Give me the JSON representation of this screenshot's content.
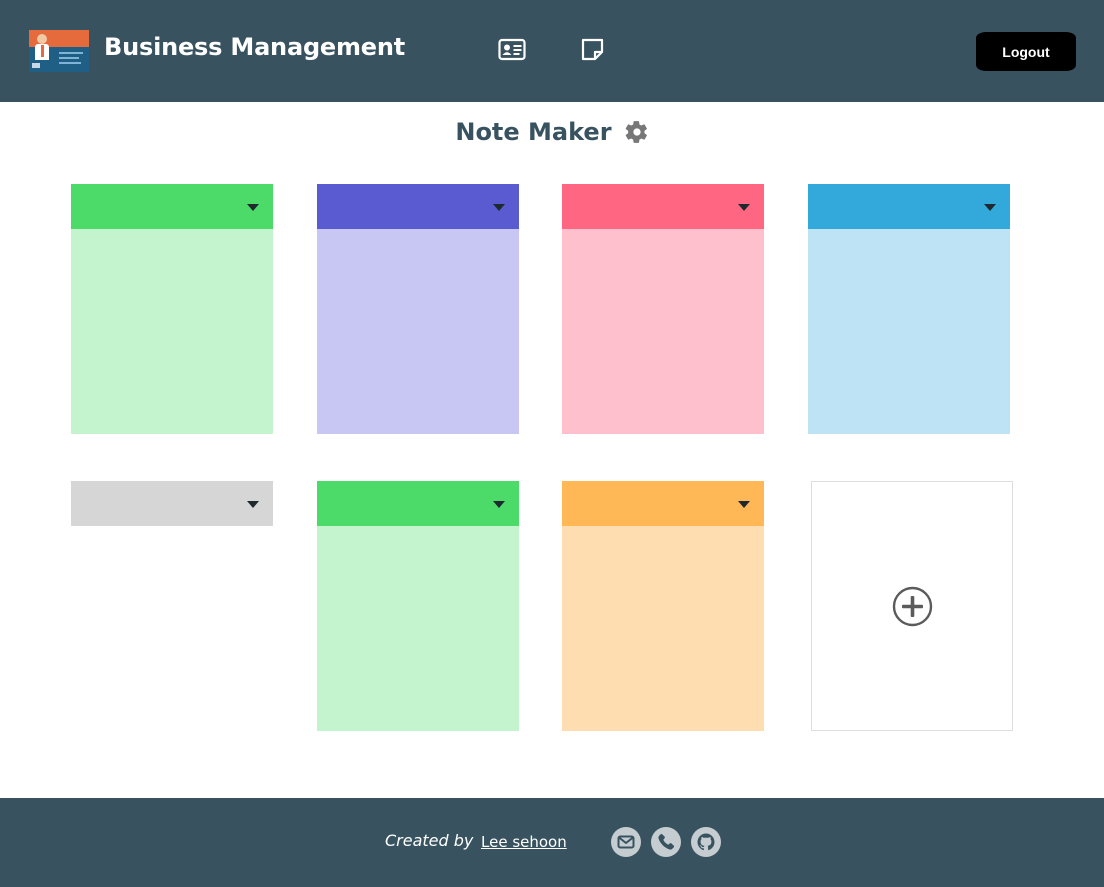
{
  "header": {
    "title": "Business Management",
    "nav": [
      {
        "icon": "id-card-icon"
      },
      {
        "icon": "sticky-note-icon"
      }
    ],
    "logout_label": "Logout",
    "background": "#38535f"
  },
  "main": {
    "title": "Note Maker",
    "settings_icon": "gear-icon",
    "notes": [
      {
        "header_color": "#4cdb68",
        "body_color": "#c4f4cd",
        "collapsed": false
      },
      {
        "header_color": "#5b5bd1",
        "body_color": "#c8c7f4",
        "collapsed": false
      },
      {
        "header_color": "#ff6681",
        "body_color": "#ffc0cd",
        "collapsed": false
      },
      {
        "header_color": "#33a8db",
        "body_color": "#bde3f5",
        "collapsed": false
      },
      {
        "header_color": "#d6d6d6",
        "body_color": "#ffffff",
        "collapsed": true
      },
      {
        "header_color": "#4cdb68",
        "body_color": "#c4f4cd",
        "collapsed": false
      },
      {
        "header_color": "#ffb855",
        "body_color": "#fedeb1",
        "collapsed": false
      }
    ],
    "add_icon": "plus-circle-icon"
  },
  "footer": {
    "created_by": "Created by",
    "author": "Lee sehoon",
    "social": [
      "mail-icon",
      "phone-icon",
      "github-icon"
    ]
  }
}
